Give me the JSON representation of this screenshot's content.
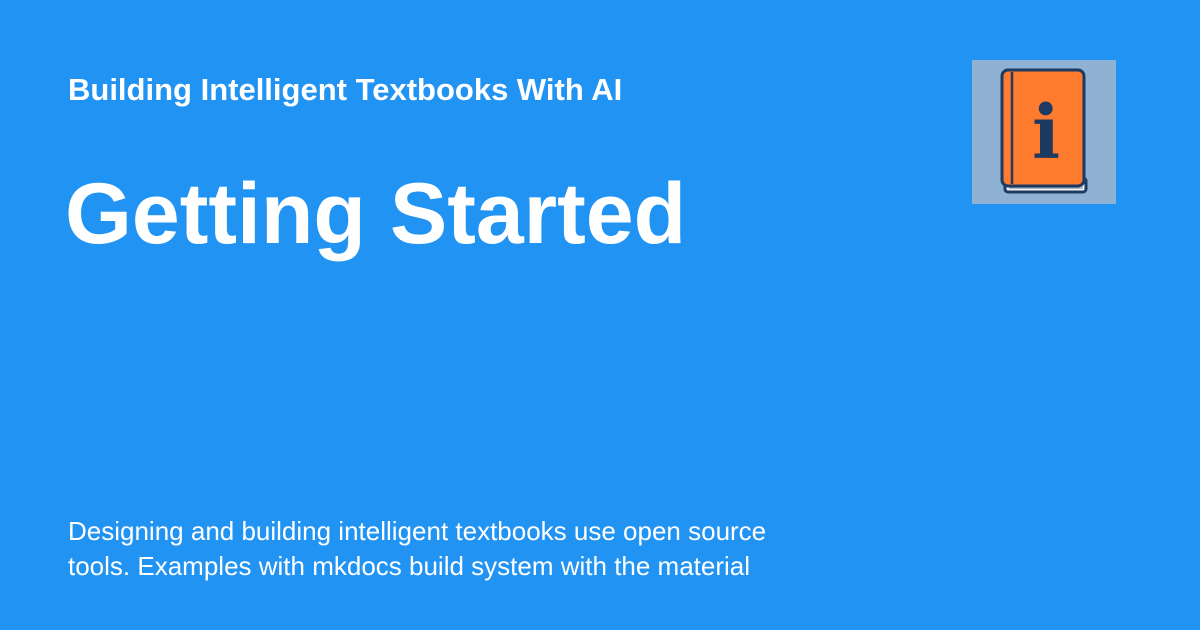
{
  "card": {
    "site_name": "Building Intelligent Textbooks With AI",
    "page_title": "Getting Started",
    "description": "Designing and building intelligent textbooks use open source\ntools.  Examples with mkdocs build system with the material",
    "logo": {
      "icon": "book-info-icon",
      "glyph": "i"
    }
  },
  "colors": {
    "background": "#2193f3",
    "text": "#ffffff",
    "logo_background": "#8fb1d3",
    "book_cover": "#ff7b2e",
    "book_outline": "#1d3a63"
  }
}
